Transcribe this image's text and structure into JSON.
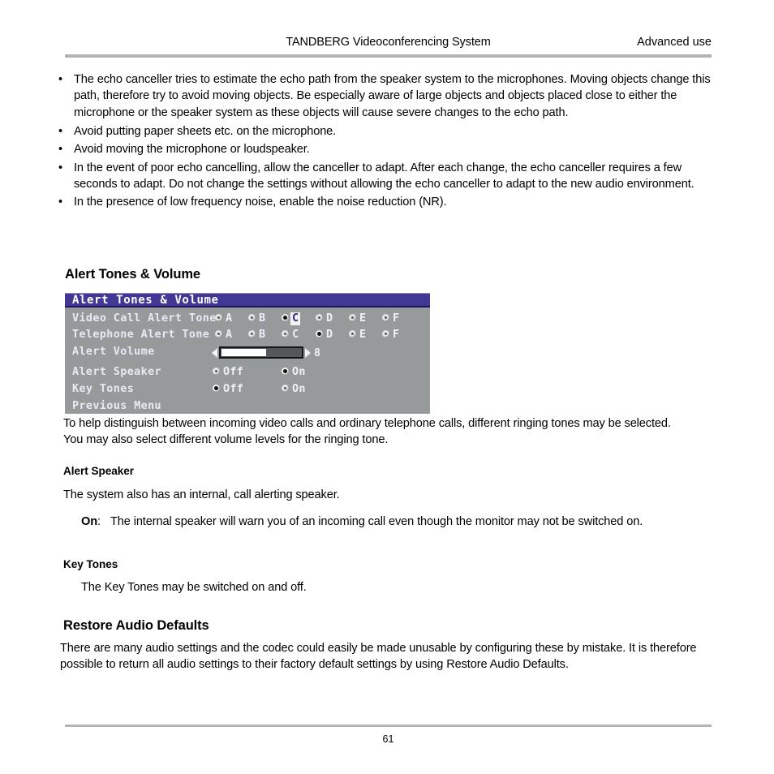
{
  "header": {
    "center_title": "TANDBERG Videoconferencing System",
    "right_title": "Advanced use"
  },
  "footer": {
    "page_number": "61"
  },
  "bullets": [
    {
      "marker": "•",
      "text": "The echo canceller tries to estimate the echo path from the speaker system to the microphones. Moving objects change this path, therefore try to avoid moving objects. Be especially aware of large objects and objects placed close to either the microphone or the speaker system as these objects will cause severe changes to the echo path."
    },
    {
      "marker": "•",
      "text": "Avoid putting paper sheets etc. on the microphone."
    },
    {
      "marker": "•",
      "text": "Avoid moving the microphone or loudspeaker."
    },
    {
      "marker": "•",
      "text": "In the event of poor echo cancelling, allow the canceller to adapt. After each change, the echo canceller requires a few seconds to adapt. Do not change the settings without allowing the echo canceller to adapt to the new audio environment."
    },
    {
      "marker": "•",
      "text": "In the presence of low frequency noise, enable the noise reduction (NR)."
    }
  ],
  "sections": {
    "alert_tones_heading": "Alert Tones & Volume",
    "alert_tones_body": "To help distinguish between incoming video calls and ordinary telephone calls, different ringing tones may be selected. You may also select different volume levels for the ringing tone.",
    "alert_speaker_heading": "Alert Speaker",
    "alert_speaker_body": "The system also has an internal, call alerting speaker.",
    "alert_speaker_on_term": "On",
    "alert_speaker_on_colon": ":",
    "alert_speaker_on_text": "The internal speaker will warn you of an incoming call even though the monitor may not be switched on.",
    "key_tones_heading": "Key Tones",
    "key_tones_body": "The Key Tones may be switched on and off.",
    "restore_heading": "Restore Audio Defaults",
    "restore_body": "There are many audio settings and the codec could easily be made unusable by configuring these by mistake. It is therefore possible to return all audio settings to their factory default settings by using Restore Audio Defaults."
  },
  "osd": {
    "title": "Alert Tones & Volume",
    "colors": {
      "title_bar": "#413795",
      "body": "#969a9b",
      "text": "#e9e9f4",
      "highlight_bg": "#f2f2f2",
      "highlight_text": "#2b2585"
    },
    "rows": {
      "video_call_alert_tone": {
        "label": "Video Call Alert Tone",
        "options": [
          "A",
          "B",
          "C",
          "D",
          "E",
          "F"
        ],
        "selected": "C",
        "focused": "C"
      },
      "telephone_alert_tone": {
        "label": "Telephone Alert Tone",
        "options": [
          "A",
          "B",
          "C",
          "D",
          "E",
          "F"
        ],
        "selected": "D",
        "focused": ""
      },
      "alert_volume": {
        "label": "Alert Volume",
        "value": "8",
        "fill_percent": 55,
        "left_arrow": "◀",
        "right_arrow": "▶"
      },
      "alert_speaker": {
        "label": "Alert Speaker",
        "options": [
          "Off",
          "On"
        ],
        "selected": "On"
      },
      "key_tones": {
        "label": "Key Tones",
        "options": [
          "Off",
          "On"
        ],
        "selected": "Off"
      },
      "previous_menu": {
        "label": "Previous Menu"
      }
    }
  }
}
